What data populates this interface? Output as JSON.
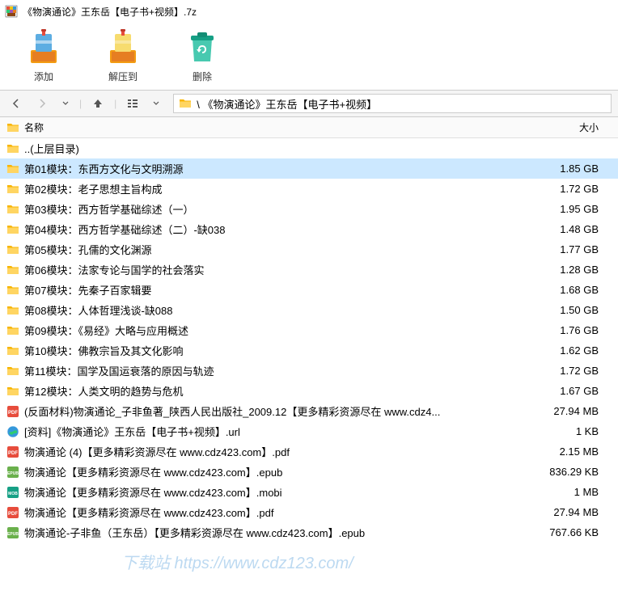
{
  "window": {
    "title": "《物演通论》王东岳【电子书+视频】.7z"
  },
  "toolbar": {
    "add": "添加",
    "extract": "解压到",
    "delete": "删除"
  },
  "path": {
    "text": "\\ 《物演通论》王东岳【电子书+视频】"
  },
  "columns": {
    "name": "名称",
    "size": "大小"
  },
  "files": [
    {
      "icon": "folder",
      "name": "..(上层目录)",
      "size": ""
    },
    {
      "icon": "folder",
      "name": "第01模块：东西方文化与文明溯源",
      "size": "1.85 GB",
      "selected": true
    },
    {
      "icon": "folder",
      "name": "第02模块：老子思想主旨构成",
      "size": "1.72 GB"
    },
    {
      "icon": "folder",
      "name": "第03模块：西方哲学基础综述（一）",
      "size": "1.95 GB"
    },
    {
      "icon": "folder",
      "name": "第04模块：西方哲学基础综述（二）-缺038",
      "size": "1.48 GB"
    },
    {
      "icon": "folder",
      "name": "第05模块：孔儒的文化渊源",
      "size": "1.77 GB"
    },
    {
      "icon": "folder",
      "name": "第06模块：法家专论与国学的社会落实",
      "size": "1.28 GB"
    },
    {
      "icon": "folder",
      "name": "第07模块：先秦子百家辑要",
      "size": "1.68 GB"
    },
    {
      "icon": "folder",
      "name": "第08模块：人体哲理浅谈-缺088",
      "size": "1.50 GB"
    },
    {
      "icon": "folder",
      "name": "第09模块：《易经》大略与应用概述",
      "size": "1.76 GB"
    },
    {
      "icon": "folder",
      "name": "第10模块：佛教宗旨及其文化影响",
      "size": "1.62 GB"
    },
    {
      "icon": "folder",
      "name": "第11模块：国学及国运衰落的原因与轨迹",
      "size": "1.72 GB"
    },
    {
      "icon": "folder",
      "name": "第12模块：人类文明的趋势与危机",
      "size": "1.67 GB"
    },
    {
      "icon": "pdf",
      "name": "(反面材料)物演通论_子非鱼著_陕西人民出版社_2009.12【更多精彩资源尽在 www.cdz4...",
      "size": "27.94 MB"
    },
    {
      "icon": "url",
      "name": "[资料]《物演通论》王东岳【电子书+视频】.url",
      "size": "1 KB"
    },
    {
      "icon": "pdf",
      "name": "物演通论 (4)【更多精彩资源尽在 www.cdz423.com】.pdf",
      "size": "2.15 MB"
    },
    {
      "icon": "epub",
      "name": "物演通论【更多精彩资源尽在 www.cdz423.com】.epub",
      "size": "836.29 KB"
    },
    {
      "icon": "mobi",
      "name": "物演通论【更多精彩资源尽在 www.cdz423.com】.mobi",
      "size": "1 MB"
    },
    {
      "icon": "pdf",
      "name": "物演通论【更多精彩资源尽在 www.cdz423.com】.pdf",
      "size": "27.94 MB"
    },
    {
      "icon": "epub",
      "name": "物演通论-子非鱼（王东岳）【更多精彩资源尽在 www.cdz423.com】.epub",
      "size": "767.66 KB"
    }
  ],
  "watermark": "下载站 https://www.cdz123.com/"
}
